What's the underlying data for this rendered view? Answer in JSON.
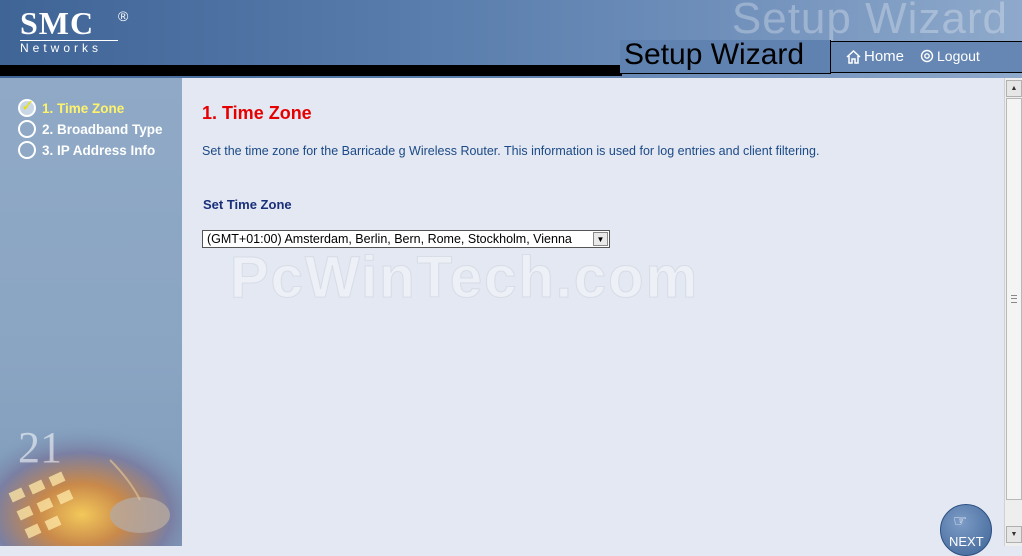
{
  "header": {
    "logo_main": "SMC",
    "logo_reg": "®",
    "logo_sub": "Networks",
    "ghost_title": "Setup Wizard",
    "title": "Setup Wizard",
    "home_label": "Home",
    "logout_label": "Logout"
  },
  "sidebar": {
    "steps": [
      {
        "label": "1. Time Zone",
        "state": "active"
      },
      {
        "label": "2. Broadband Type",
        "state": "pending"
      },
      {
        "label": "3. IP Address Info",
        "state": "pending"
      }
    ],
    "deco_text": "21"
  },
  "main": {
    "title": "1. Time Zone",
    "description": "Set the time zone for the Barricade g Wireless Router. This information is used for log entries and client filtering.",
    "field_label": "Set Time Zone",
    "timezone_value": "(GMT+01:00) Amsterdam, Berlin, Bern, Rome, Stockholm, Vienna",
    "watermark": "PcWinTech.com",
    "next_label": "NEXT"
  },
  "colors": {
    "header_blue": "#5b7fae",
    "title_red": "#e60000",
    "active_step": "#fff36a",
    "desc_text": "#1c4a86"
  }
}
